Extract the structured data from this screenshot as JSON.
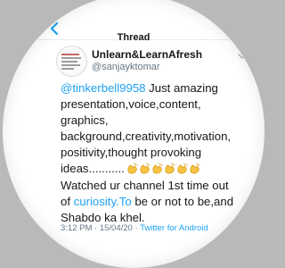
{
  "nav": {
    "title": "Thread",
    "back_icon": "chevron-left-icon"
  },
  "user": {
    "display_name": "Unlearn&LearnAfresh",
    "handle": "@sanjayktomar"
  },
  "tweet": {
    "mention": "@tinkerbell9958",
    "line1_rest": " Just amazing",
    "line2": "presentation,voice,content,",
    "line3": "graphics,",
    "line4": "background,creativity,motivation,",
    "line5": "positivity,thought provoking",
    "line6": "ideas...........",
    "emoji_count": 6,
    "emoji_name": "clapping-hands-icon",
    "line7": "Watched ur channel 1st time out",
    "line8_prefix": "of ",
    "link": "curiosity.To",
    "line8_rest": " be or not to be,and",
    "line9": "Shabdo ka khel."
  },
  "meta": {
    "time": "3:12 PM",
    "separator": " · ",
    "date": "15/04/20",
    "source": "Twitter for Android"
  },
  "colors": {
    "accent": "#1da1f2",
    "text": "#14171a",
    "muted": "#657786",
    "background_outer": "#b9b9b9",
    "emoji": "#f6c343"
  }
}
